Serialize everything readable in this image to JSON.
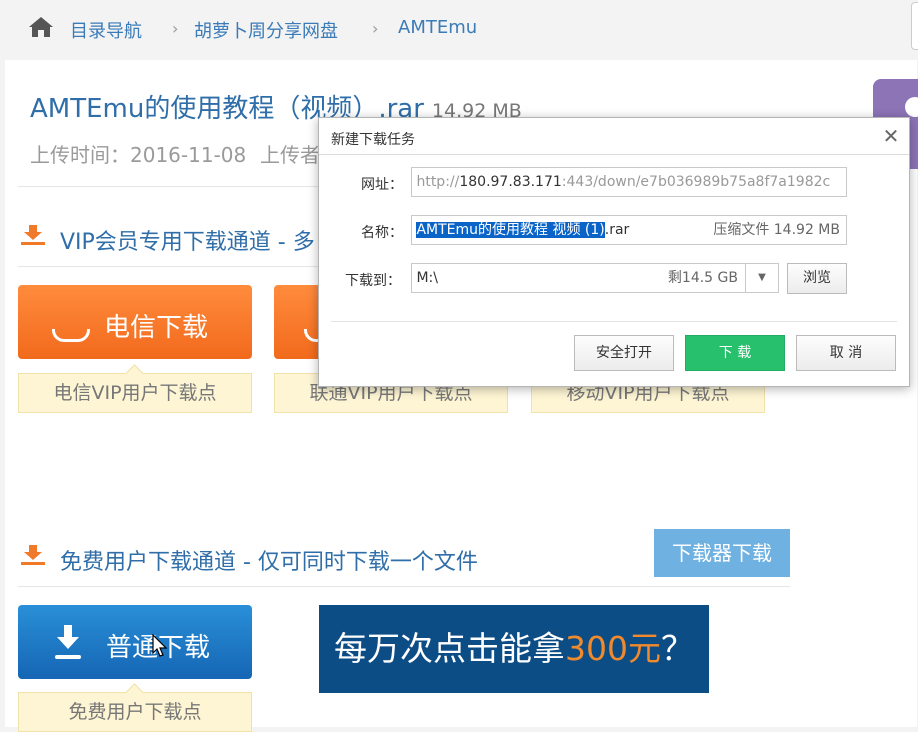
{
  "breadcrumb": {
    "items": [
      "目录导航",
      "胡萝卜周分享网盘",
      "AMTEmu"
    ]
  },
  "file": {
    "title": "AMTEmu的使用教程（视频）.rar",
    "size": "14.92 MB",
    "upload_time": "上传时间：2016-11-08",
    "uploader_partial": "上传者"
  },
  "vip_section": {
    "title": "VIP会员专用下载通道 - 多",
    "buttons": [
      {
        "label": "电信下载",
        "tip": "电信VIP用户下载点"
      },
      {
        "label": "",
        "tip": "联通VIP用户下载点"
      },
      {
        "label": "",
        "tip": "移动VIP用户下载点"
      }
    ]
  },
  "free_section": {
    "title": "免费用户下载通道 - 仅可同时下载一个文件",
    "downloader_button": "下载器下载",
    "normal_button": "普通下载",
    "normal_tip": "免费用户下载点"
  },
  "ad": {
    "text_before": "每万次点击能拿",
    "highlight": "300元",
    "text_after": "？"
  },
  "dialog": {
    "title": "新建下载任务",
    "url_label": "网址：",
    "url_prefix": "http://",
    "url_host": "180.97.83.171",
    "url_rest": ":443/down/e7b036989b75a8f7a1982c",
    "name_label": "名称：",
    "name_selected": "AMTEmu的使用教程 视频 (1)",
    "name_ext": ".rar",
    "name_kind": "压缩文件 14.92 MB",
    "saveto_label": "下载到：",
    "saveto_value": "M:\\",
    "saveto_free": "剩14.5 GB",
    "browse": "浏览",
    "btn_open": "安全打开",
    "btn_download": "下 载",
    "btn_cancel": "取 消"
  },
  "colors": {
    "link_blue": "#2f6ea8",
    "orange": "#f26a1c",
    "blue_button": "#1566b4",
    "green": "#27c06d",
    "ad_bg": "#0d4d86"
  }
}
